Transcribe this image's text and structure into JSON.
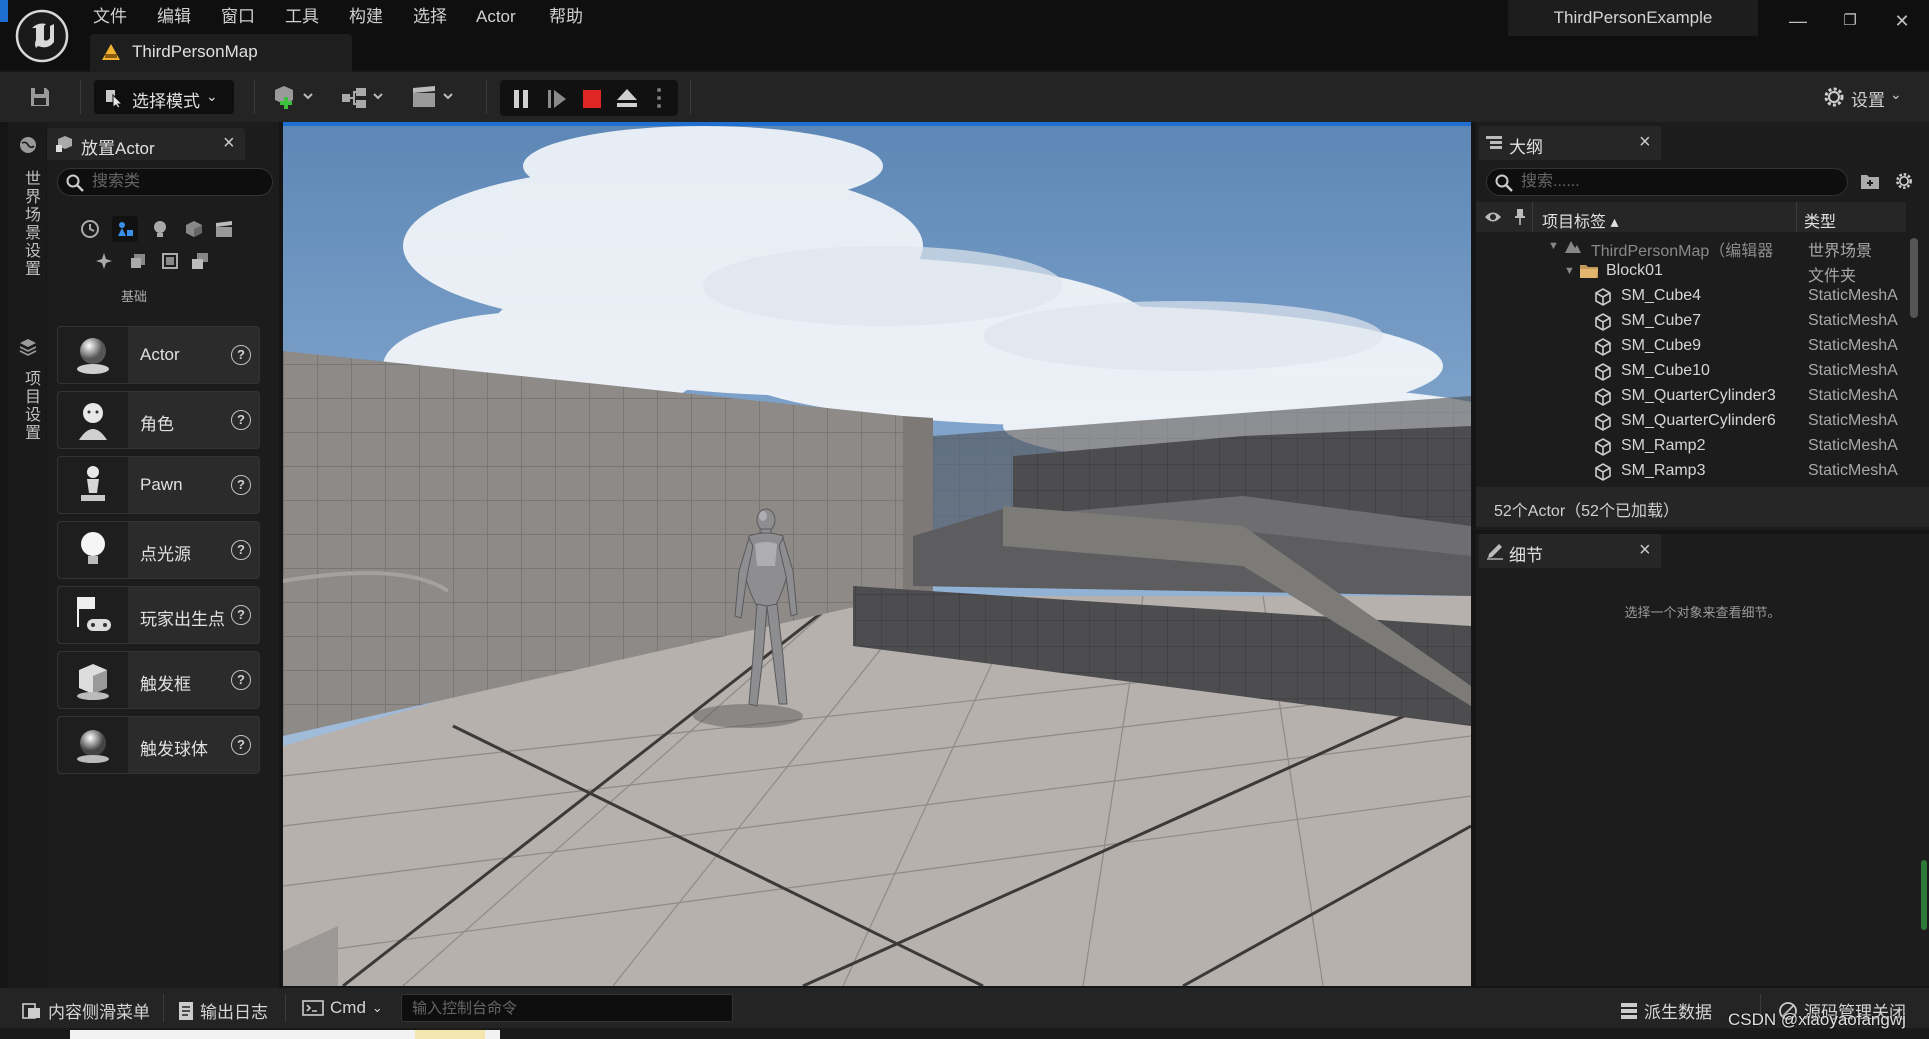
{
  "app": {
    "project_name": "ThirdPersonExample",
    "menu": [
      "文件",
      "编辑",
      "窗口",
      "工具",
      "构建",
      "选择",
      "Actor",
      "帮助"
    ],
    "level_tab": "ThirdPersonMap",
    "window_controls": {
      "minimize": "—",
      "restore": "❐",
      "close": "✕"
    }
  },
  "toolbar": {
    "mode_label": "选择模式",
    "settings_label": "设置"
  },
  "left_strip": {
    "world_settings": "世界场景设置",
    "project_settings": "项目设置"
  },
  "place_actors": {
    "title": "放置Actor",
    "close": "×",
    "search_placeholder": "搜索类",
    "category_label": "基础",
    "items": [
      {
        "label": "Actor"
      },
      {
        "label": "角色"
      },
      {
        "label": "Pawn"
      },
      {
        "label": "点光源"
      },
      {
        "label": "玩家出生点"
      },
      {
        "label": "触发框"
      },
      {
        "label": "触发球体"
      }
    ],
    "help": "?"
  },
  "outliner": {
    "title": "大纲",
    "close": "×",
    "search_placeholder": "搜索......",
    "columns": {
      "label": "项目标签 ▴",
      "type": "类型"
    },
    "rows": [
      {
        "name": "ThirdPersonMap（编辑器",
        "type": "世界场景"
      },
      {
        "name": "Block01",
        "type": "文件夹"
      },
      {
        "name": "SM_Cube4",
        "type": "StaticMeshA"
      },
      {
        "name": "SM_Cube7",
        "type": "StaticMeshA"
      },
      {
        "name": "SM_Cube9",
        "type": "StaticMeshA"
      },
      {
        "name": "SM_Cube10",
        "type": "StaticMeshA"
      },
      {
        "name": "SM_QuarterCylinder3",
        "type": "StaticMeshA"
      },
      {
        "name": "SM_QuarterCylinder6",
        "type": "StaticMeshA"
      },
      {
        "name": "SM_Ramp2",
        "type": "StaticMeshA"
      },
      {
        "name": "SM_Ramp3",
        "type": "StaticMeshA"
      }
    ],
    "footer": "52个Actor（52个已加载）"
  },
  "details": {
    "title": "细节",
    "close": "×",
    "empty_message": "选择一个对象来查看细节。"
  },
  "bottom": {
    "content_drawer": "内容侧滑菜单",
    "output_log": "输出日志",
    "cmd": "Cmd",
    "cmd_placeholder": "输入控制台命令",
    "derived_data": "派生数据",
    "source_control": "源码管理关闭",
    "watermark": "CSDN @xiaoyaofangwj"
  },
  "colors": {
    "accent": "#1f6fd0",
    "stop": "#e02525",
    "warning": "#f0b030"
  }
}
